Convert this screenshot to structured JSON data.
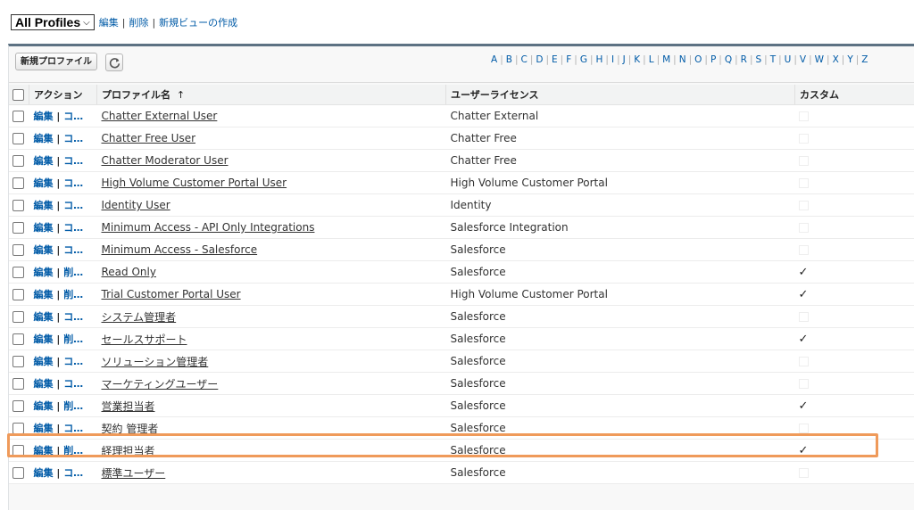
{
  "view": {
    "selected": "All Profiles",
    "links": [
      "編集",
      "削除",
      "新規ビューの作成"
    ]
  },
  "toolbar": {
    "new_button": "新規プロファイル",
    "alphabet": [
      "A",
      "B",
      "C",
      "D",
      "E",
      "F",
      "G",
      "H",
      "I",
      "J",
      "K",
      "L",
      "M",
      "N",
      "O",
      "P",
      "Q",
      "R",
      "S",
      "T",
      "U",
      "V",
      "W",
      "X",
      "Y",
      "Z"
    ]
  },
  "table": {
    "headers": {
      "action": "アクション",
      "profile": "プロファイル名",
      "sort_indicator": "↑",
      "license": "ユーザーライセンス",
      "custom": "カスタム"
    },
    "rows": [
      {
        "edit": "編集",
        "second": "コ…",
        "name": "Chatter External User",
        "license": "Chatter External",
        "custom": false
      },
      {
        "edit": "編集",
        "second": "コ…",
        "name": "Chatter Free User",
        "license": "Chatter Free",
        "custom": false
      },
      {
        "edit": "編集",
        "second": "コ…",
        "name": "Chatter Moderator User",
        "license": "Chatter Free",
        "custom": false
      },
      {
        "edit": "編集",
        "second": "コ…",
        "name": "High Volume Customer Portal User",
        "license": "High Volume Customer Portal",
        "custom": false
      },
      {
        "edit": "編集",
        "second": "コ…",
        "name": "Identity User",
        "license": "Identity",
        "custom": false
      },
      {
        "edit": "編集",
        "second": "コ…",
        "name": "Minimum Access - API Only Integrations",
        "license": "Salesforce Integration",
        "custom": false
      },
      {
        "edit": "編集",
        "second": "コ…",
        "name": "Minimum Access - Salesforce",
        "license": "Salesforce",
        "custom": false
      },
      {
        "edit": "編集",
        "second": "削…",
        "name": "Read Only",
        "license": "Salesforce",
        "custom": true
      },
      {
        "edit": "編集",
        "second": "削…",
        "name": "Trial Customer Portal User",
        "license": "High Volume Customer Portal",
        "custom": true
      },
      {
        "edit": "編集",
        "second": "コ…",
        "name": "システム管理者",
        "license": "Salesforce",
        "custom": false
      },
      {
        "edit": "編集",
        "second": "削…",
        "name": "セールスサポート",
        "license": "Salesforce",
        "custom": true
      },
      {
        "edit": "編集",
        "second": "コ…",
        "name": "ソリューション管理者",
        "license": "Salesforce",
        "custom": false
      },
      {
        "edit": "編集",
        "second": "コ…",
        "name": "マーケティングユーザー",
        "license": "Salesforce",
        "custom": false
      },
      {
        "edit": "編集",
        "second": "削…",
        "name": "営業担当者",
        "license": "Salesforce",
        "custom": true
      },
      {
        "edit": "編集",
        "second": "コ…",
        "name": "契約 管理者",
        "license": "Salesforce",
        "custom": false
      },
      {
        "edit": "編集",
        "second": "削…",
        "name": "経理担当者",
        "license": "Salesforce",
        "custom": true
      },
      {
        "edit": "編集",
        "second": "コ…",
        "name": "標準ユーザー",
        "license": "Salesforce",
        "custom": false
      }
    ]
  },
  "check_glyph": "✓",
  "highlight_color": "#ef9a5a",
  "link_color": "#015ba7"
}
